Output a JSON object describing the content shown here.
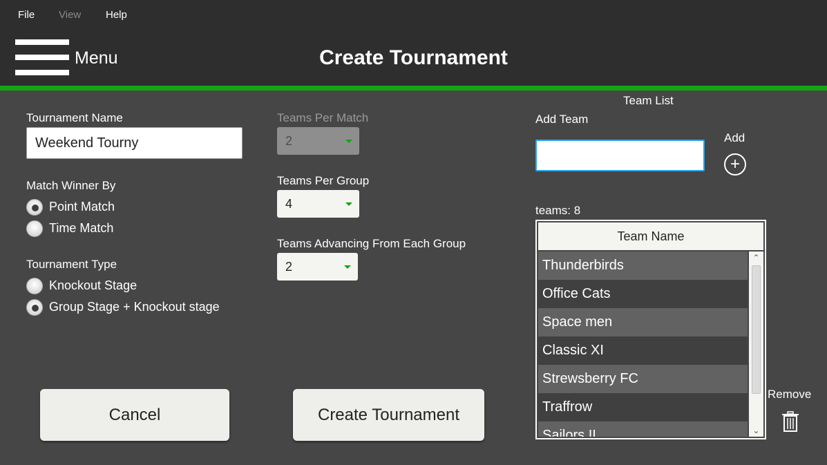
{
  "menubar": {
    "file": "File",
    "view": "View",
    "help": "Help"
  },
  "header": {
    "menu_label": "Menu",
    "title": "Create Tournament"
  },
  "form": {
    "tournament_name_label": "Tournament Name",
    "tournament_name_value": "Weekend Tourny",
    "match_winner_label": "Match Winner By",
    "match_winner_options": [
      "Point Match",
      "Time Match"
    ],
    "match_winner_selected": "Point Match",
    "tournament_type_label": "Tournament Type",
    "tournament_type_options": [
      "Knockout Stage",
      "Group Stage + Knockout stage"
    ],
    "tournament_type_selected": "Group Stage + Knockout stage",
    "teams_per_match_label": "Teams Per Match",
    "teams_per_match_value": "2",
    "teams_per_group_label": "Teams Per Group",
    "teams_per_group_value": "4",
    "teams_advancing_label": "Teams Advancing From Each Group",
    "teams_advancing_value": "2"
  },
  "team_panel": {
    "title": "Team List",
    "add_team_label": "Add Team",
    "add_team_value": "",
    "add_label": "Add",
    "add_icon": "plus-circle-icon",
    "count_text": "teams: 8",
    "column_header": "Team Name",
    "teams": [
      "Thunderbirds",
      "Office Cats",
      "Space men",
      "Classic XI",
      "Strewsberry FC",
      "Traffrow",
      "Sailors II"
    ],
    "remove_label": "Remove",
    "remove_icon": "trash-icon"
  },
  "buttons": {
    "cancel": "Cancel",
    "create": "Create Tournament"
  },
  "colors": {
    "accent_green": "#11a611",
    "focus_blue": "#2ba5e8",
    "header_bg": "#2e2e2e",
    "body_bg": "#464646"
  }
}
